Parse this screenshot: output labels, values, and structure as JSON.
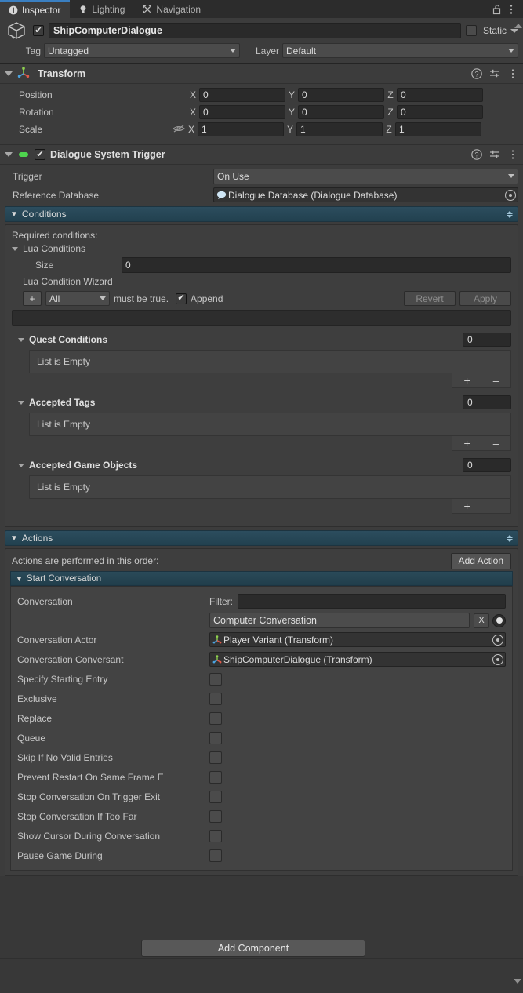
{
  "window": {
    "tabs": [
      {
        "label": "Inspector",
        "icon": "info-icon",
        "active": true
      },
      {
        "label": "Lighting",
        "icon": "lightbulb-icon",
        "active": false
      },
      {
        "label": "Navigation",
        "icon": "navigation-icon",
        "active": false
      }
    ],
    "lock_icon": "padlock-icon",
    "menu_icon": "kebab-menu-icon",
    "accent_color": "#3a7fc1",
    "bg_color": "#383838",
    "panel_color": "#3c3c3c",
    "section_color": "#22414f"
  },
  "gameobject": {
    "enabled": true,
    "name": "ShipComputerDialogue",
    "static_label": "Static",
    "static_checked": false,
    "tag_label": "Tag",
    "tag_value": "Untagged",
    "layer_label": "Layer",
    "layer_value": "Default",
    "icon": "cube-icon"
  },
  "transform": {
    "title": "Transform",
    "icon": "transform-axis-icon",
    "help_icon": "help-icon",
    "preset_icon": "preset-sliders-icon",
    "menu_icon": "kebab-menu-icon",
    "rows": [
      {
        "label": "Position",
        "x": "0",
        "y": "0",
        "z": "0",
        "hidden_icon": false
      },
      {
        "label": "Rotation",
        "x": "0",
        "y": "0",
        "z": "0",
        "hidden_icon": false
      },
      {
        "label": "Scale",
        "x": "1",
        "y": "1",
        "z": "1",
        "hidden_icon": true
      }
    ],
    "axis_labels": [
      "X",
      "Y",
      "Z"
    ]
  },
  "dialogue_trigger": {
    "title": "Dialogue System Trigger",
    "enabled": true,
    "icon": "script-icon",
    "help_icon": "help-icon",
    "preset_icon": "preset-sliders-icon",
    "menu_icon": "kebab-menu-icon",
    "trigger_label": "Trigger",
    "trigger_value": "On Use",
    "reference_db_label": "Reference Database",
    "reference_db_value": "Dialogue Database (Dialogue Database)",
    "reference_db_icon": "dialogue-database-icon"
  },
  "conditions": {
    "header": "Conditions",
    "required_label": "Required conditions:",
    "lua_conditions_label": "Lua Conditions",
    "size_label": "Size",
    "size_value": "0",
    "wizard_label": "Lua Condition Wizard",
    "add_button": "+",
    "all_dropdown": "All",
    "must_be_true": "must be true.",
    "append_label": "Append",
    "append_checked": true,
    "revert_button": "Revert",
    "apply_button": "Apply",
    "lists": [
      {
        "title": "Quest Conditions",
        "count": "0",
        "empty_text": "List is Empty",
        "add": "+",
        "remove": "–"
      },
      {
        "title": "Accepted Tags",
        "count": "0",
        "empty_text": "List is Empty",
        "add": "+",
        "remove": "–"
      },
      {
        "title": "Accepted Game Objects",
        "count": "0",
        "empty_text": "List is Empty",
        "add": "+",
        "remove": "–"
      }
    ]
  },
  "actions": {
    "header": "Actions",
    "order_text": "Actions are performed in this order:",
    "add_action_button": "Add Action",
    "start_conversation_header": "Start Conversation",
    "conversation_label": "Conversation",
    "filter_label": "Filter:",
    "filter_value": "",
    "conversation_value": "Computer Conversation",
    "clear_button": "X",
    "picker_icon": "target-picker-icon",
    "actor_label": "Conversation Actor",
    "actor_value": "Player Variant (Transform)",
    "actor_icon": "transform-axis-icon",
    "conversant_label": "Conversation Conversant",
    "conversant_value": "ShipComputerDialogue (Transform)",
    "conversant_icon": "transform-axis-icon",
    "checkboxes": [
      {
        "label": "Specify Starting Entry",
        "checked": false
      },
      {
        "label": "Exclusive",
        "checked": false
      },
      {
        "label": "Replace",
        "checked": false
      },
      {
        "label": "Queue",
        "checked": false
      },
      {
        "label": "Skip If No Valid Entries",
        "checked": false
      },
      {
        "label": "Prevent Restart On Same Frame E",
        "checked": false
      },
      {
        "label": "Stop Conversation On Trigger Exit",
        "checked": false
      },
      {
        "label": "Stop Conversation If Too Far",
        "checked": false
      },
      {
        "label": "Show Cursor During Conversation",
        "checked": false
      },
      {
        "label": "Pause Game During",
        "checked": false
      }
    ]
  },
  "footer": {
    "add_component_button": "Add Component"
  }
}
